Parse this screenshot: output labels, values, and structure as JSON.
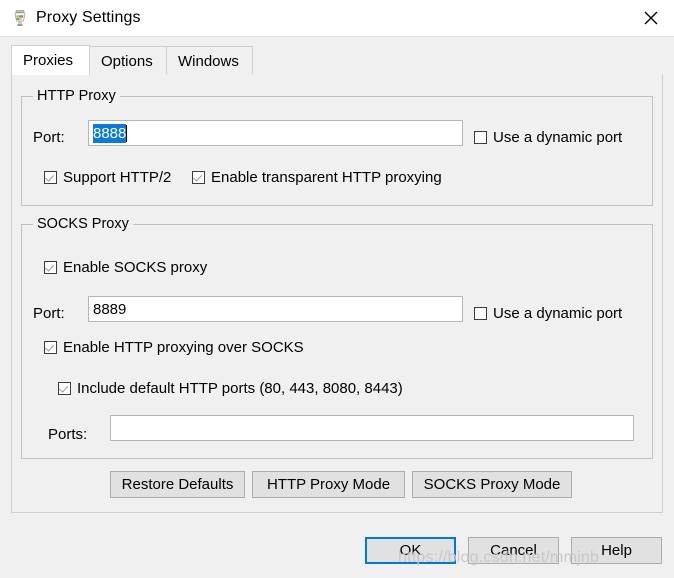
{
  "window": {
    "title": "Proxy Settings",
    "app_icon": "charles-proxy-icon",
    "close_icon": "close-icon"
  },
  "tabs": [
    {
      "label": "Proxies",
      "selected": true
    },
    {
      "label": "Options",
      "selected": false
    },
    {
      "label": "Windows",
      "selected": false
    }
  ],
  "http_proxy": {
    "group_title": "HTTP Proxy",
    "port_label": "Port:",
    "port_value": "8888",
    "port_selected": true,
    "dynamic_port_label": "Use a dynamic port",
    "dynamic_port_checked": false,
    "support_http2_label": "Support HTTP/2",
    "support_http2_checked": true,
    "transparent_label": "Enable transparent HTTP proxying",
    "transparent_checked": true
  },
  "socks_proxy": {
    "group_title": "SOCKS Proxy",
    "enable_label": "Enable SOCKS proxy",
    "enable_checked": true,
    "port_label": "Port:",
    "port_value": "8889",
    "dynamic_port_label": "Use a dynamic port",
    "dynamic_port_checked": false,
    "http_over_socks_label": "Enable HTTP proxying over SOCKS",
    "http_over_socks_checked": true,
    "include_default_ports_label": "Include default HTTP ports (80, 443, 8080, 8443)",
    "include_default_ports_checked": true,
    "ports_label": "Ports:",
    "ports_value": "",
    "ports_placeholder": ""
  },
  "action_buttons": {
    "restore_defaults": "Restore Defaults",
    "http_proxy_mode": "HTTP Proxy Mode",
    "socks_proxy_mode": "SOCKS Proxy Mode"
  },
  "dialog_buttons": {
    "ok": "OK",
    "cancel": "Cancel",
    "help": "Help"
  },
  "watermark": {
    "text": "https://blog.csdn.net/mmjnb"
  },
  "colors": {
    "selection_blue": "#0a7ae0",
    "focus_blue": "#0078d7",
    "dialog_bg": "#f0f0f0",
    "field_bg": "#ffffff",
    "border_gray": "#c2c2c2"
  }
}
